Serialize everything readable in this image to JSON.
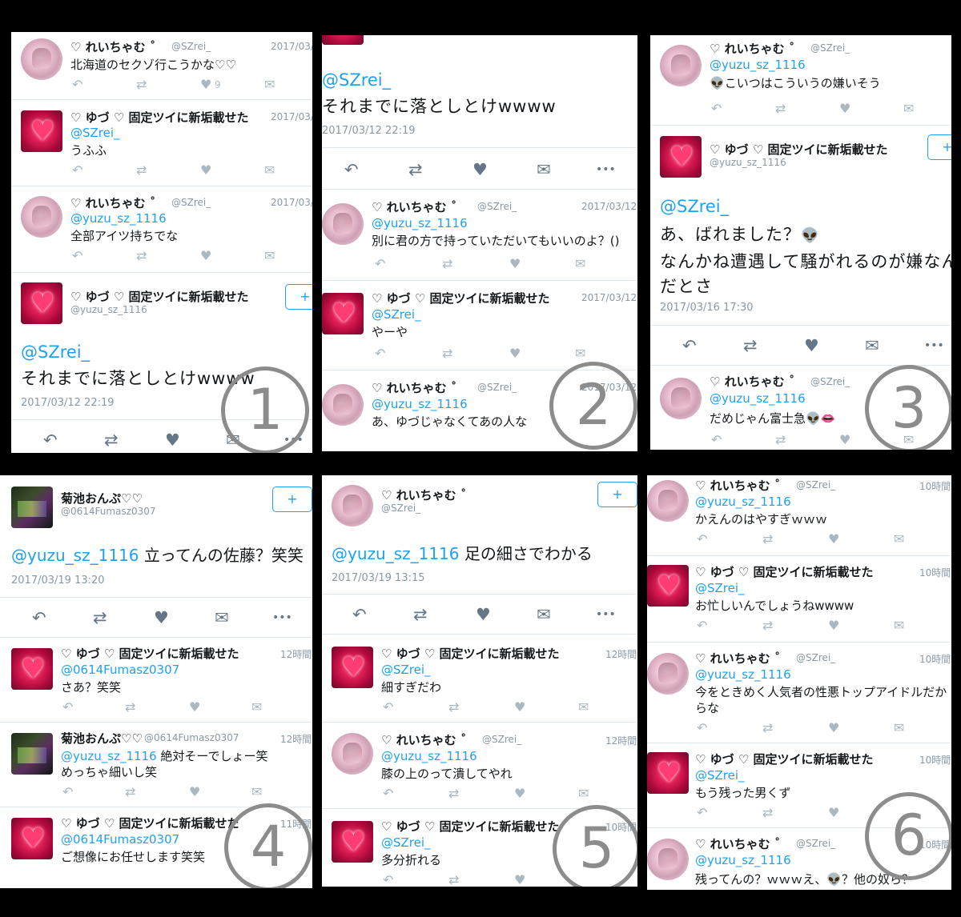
{
  "icons": {
    "reply": "↶",
    "retweet": "⇄",
    "like": "♥",
    "dm": "✉",
    "more": "•••",
    "follow": "+",
    "alien": "👽",
    "lips": "👄"
  },
  "panel1": {
    "t1": {
      "name": "♡ れいちゃむ ˚",
      "handle": "@SZrei_",
      "time": "2017/03/",
      "text": "北海道のセクゾ行こうかな♡♡",
      "likes": "9"
    },
    "t2": {
      "name": "♡ ゆづ ♡ 固定ツイに新垢載せた",
      "time": "2017/03/",
      "mention": "@SZrei_",
      "text": "うふふ"
    },
    "t3": {
      "name": "♡ れいちゃむ ˚",
      "handle": "@SZrei_",
      "time": "2017/03/",
      "mention": "@yuzu_sz_1116",
      "text": "全部アイツ持ちでな"
    },
    "t4": {
      "name": "♡ ゆづ ♡ 固定ツイに新垢載せた",
      "handle": "@yuzu_sz_1116",
      "mention": "@SZrei_",
      "text": "それまでに落としとけwwww",
      "timestamp": "2017/03/12 22:19"
    },
    "number": "1"
  },
  "panel2": {
    "top": {
      "mention": "@SZrei_",
      "text": "それまでに落としとけwwww",
      "timestamp": "2017/03/12 22:19"
    },
    "t1": {
      "name": "♡ れいちゃむ ˚",
      "handle": "@SZrei_",
      "time": "2017/03/12",
      "mention": "@yuzu_sz_1116",
      "text": "別に君の方で持っていただいてもいいのよ？()"
    },
    "t2": {
      "name": "♡ ゆづ ♡ 固定ツイに新垢載せた",
      "time": "2017/03/12",
      "mention": "@SZrei_",
      "text": "やーや"
    },
    "t3": {
      "name": "♡ れいちゃむ ˚",
      "handle": "@SZrei_",
      "time": "2017/03/12",
      "mention": "@yuzu_sz_1116",
      "text": "あ、ゆづじゃなくてあの人な"
    },
    "number": "2"
  },
  "panel3": {
    "t1": {
      "name": "♡ れいちゃむ ˚",
      "handle": "@SZrei_",
      "mention": "@yuzu_sz_1116",
      "text": "こいつはこういうの嫌いそう"
    },
    "t2": {
      "name": "♡ ゆづ ♡ 固定ツイに新垢載せた",
      "handle": "@yuzu_sz_1116",
      "mention": "@SZrei_",
      "line1": "あ、ばれました？",
      "line2": "なんかね遭遇して騒がれるのが嫌なん",
      "line3": "だとさ",
      "timestamp": "2017/03/16 17:30"
    },
    "t3": {
      "name": "♡ れいちゃむ ˚",
      "handle": "@SZrei_",
      "mention": "@yuzu_sz_1116",
      "text": "だめじゃん富士急"
    },
    "number": "3"
  },
  "panel4": {
    "main": {
      "name": "菊池おんぷ♡♡",
      "handle": "@0614Fumasz0307",
      "mention": "@yuzu_sz_1116",
      "text": "立ってんの佐藤？笑笑",
      "timestamp": "2017/03/19 13:20"
    },
    "t1": {
      "name": "♡ ゆづ ♡ 固定ツイに新垢載せた",
      "time": "12時間",
      "mention": "@0614Fumasz0307",
      "text": "さあ？笑笑"
    },
    "t2": {
      "name": "菊池おんぷ♡♡",
      "handle": "@0614Fumasz0307",
      "time": "12時間",
      "mention": "@yuzu_sz_1116",
      "text": "絶対そーでしょー笑",
      "text2": "めっちゃ細いし笑"
    },
    "t3": {
      "name": "♡ ゆづ ♡ 固定ツイに新垢載せた",
      "time": "11時間",
      "mention": "@0614Fumasz0307",
      "text": "ご想像にお任せします笑笑"
    },
    "number": "4"
  },
  "panel5": {
    "main": {
      "name": "♡ れいちゃむ ˚",
      "handle": "@SZrei_",
      "mention": "@yuzu_sz_1116",
      "text": "足の細さでわかる",
      "timestamp": "2017/03/19 13:15"
    },
    "t1": {
      "name": "♡ ゆづ ♡ 固定ツイに新垢載せた",
      "time": "12時間",
      "mention": "@SZrei_",
      "text": "細すぎだわ"
    },
    "t2": {
      "name": "♡ れいちゃむ ˚",
      "handle": "@SZrei_",
      "time": "12時間",
      "mention": "@yuzu_sz_1116",
      "text": "膝の上のって潰してやれ"
    },
    "t3": {
      "name": "♡ ゆづ ♡ 固定ツイに新垢載せた",
      "time": "10時間",
      "mention": "@SZrei_",
      "text": "多分折れる"
    },
    "number": "5"
  },
  "panel6": {
    "t1": {
      "name": "♡ れいちゃむ ˚",
      "handle": "@SZrei_",
      "time": "10時間",
      "mention": "@yuzu_sz_1116",
      "text": "かえんのはやすぎｗｗｗ"
    },
    "t2": {
      "name": "♡ ゆづ ♡ 固定ツイに新垢載せた",
      "time": "10時間",
      "mention": "@SZrei_",
      "text": "お忙しいんでしょうねwwww"
    },
    "t3": {
      "name": "♡ れいちゃむ ˚",
      "handle": "@SZrei_",
      "time": "10時間",
      "mention": "@yuzu_sz_1116",
      "text": "今をときめく人気者の性悪トップアイドルだか",
      "text2": "らな"
    },
    "t4": {
      "name": "♡ ゆづ ♡ 固定ツイに新垢載せた",
      "time": "10時間",
      "mention": "@SZrei_",
      "text": "もう残った男くず"
    },
    "t5": {
      "name": "♡ れいちゃむ ˚",
      "handle": "@SZrei_",
      "time": "10時間",
      "mention": "@yuzu_sz_1116",
      "text": "残ってんの？ｗｗｗえ、",
      "text2": "？他の奴ら？"
    },
    "number": "6"
  }
}
